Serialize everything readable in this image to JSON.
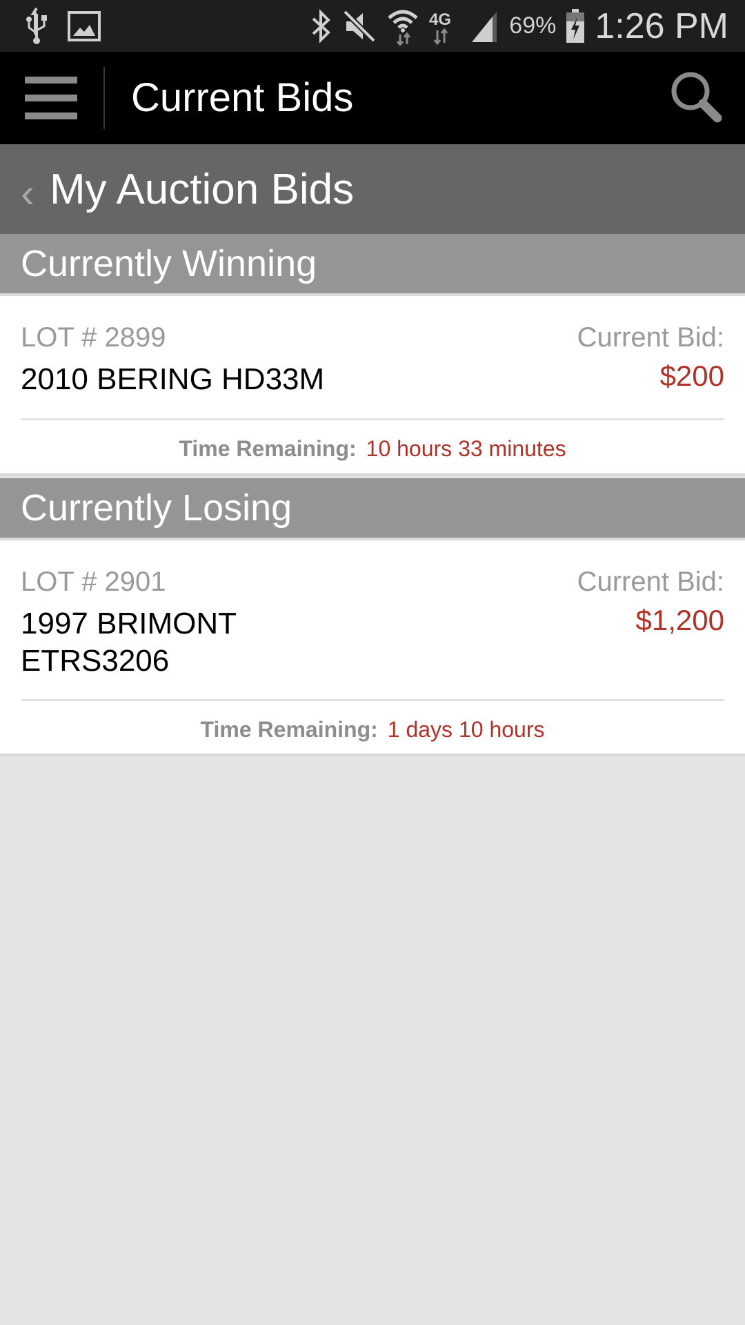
{
  "status_bar": {
    "left_icons": [
      "usb-icon",
      "image-icon"
    ],
    "right_icons": [
      "bluetooth-icon",
      "mute-icon",
      "wifi-icon",
      "4g-lte-icon",
      "signal-icon",
      "battery-charging-icon"
    ],
    "battery": "69%",
    "time": "1:26 PM"
  },
  "toolbar": {
    "menu_icon": "hamburger-menu-icon",
    "title": "Current Bids",
    "search_icon": "search-icon"
  },
  "subheader": {
    "back_icon": "chevron-left-icon",
    "back_glyph": "‹",
    "title": "My Auction Bids"
  },
  "sections": [
    {
      "title": "Currently Winning",
      "items": [
        {
          "lot": "LOT # 2899",
          "name": "2010 BERING HD33M",
          "bid_label": "Current Bid:",
          "bid_value": "$200",
          "time_label": "Time Remaining:",
          "time_value": "10 hours 33 minutes"
        }
      ]
    },
    {
      "title": "Currently Losing",
      "items": [
        {
          "lot": "LOT # 2901",
          "name": "1997 BRIMONT ETRS3206",
          "bid_label": "Current Bid:",
          "bid_value": "$1,200",
          "time_label": "Time Remaining:",
          "time_value": "1 days 10 hours"
        }
      ]
    }
  ],
  "colors": {
    "accent_red": "#b03228",
    "toolbar_bg": "#000000",
    "subheader_bg": "#666666",
    "section_bg": "#959595"
  }
}
